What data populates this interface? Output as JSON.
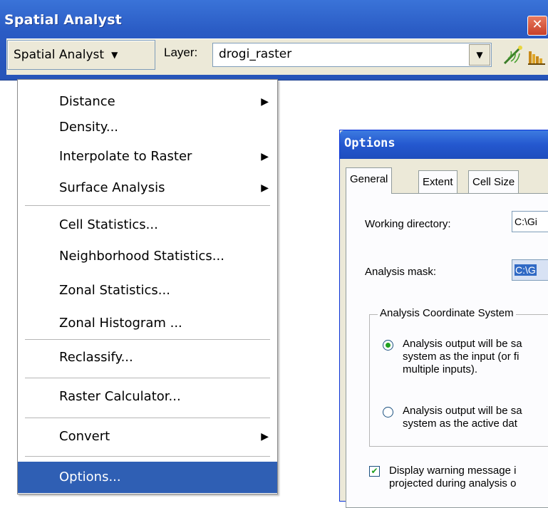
{
  "toolbar": {
    "title": "Spatial Analyst",
    "close_glyph": "✕",
    "menu_button_label": "Spatial Analyst",
    "menu_button_arrow": "▼",
    "layer_label": "Layer:",
    "layer_value": "drogi_raster",
    "layer_drop_arrow": "▼",
    "icons": [
      "contour-wand-icon",
      "histogram-icon"
    ]
  },
  "menu": {
    "items": [
      {
        "label": "Distance",
        "submenu": true
      },
      {
        "label": "Density...",
        "submenu": false
      },
      {
        "label": "Interpolate to Raster",
        "submenu": true
      },
      {
        "label": "Surface Analysis",
        "submenu": true
      },
      {
        "label": "Cell Statistics...",
        "submenu": false
      },
      {
        "label": "Neighborhood Statistics...",
        "submenu": false
      },
      {
        "label": "Zonal Statistics...",
        "submenu": false
      },
      {
        "label": "Zonal Histogram ...",
        "submenu": false
      },
      {
        "label": "Reclassify...",
        "submenu": false
      },
      {
        "label": "Raster Calculator...",
        "submenu": false
      },
      {
        "label": "Convert",
        "submenu": true
      },
      {
        "label": "Options...",
        "submenu": false,
        "selected": true
      }
    ],
    "submenu_arrow": "▶",
    "highlight_color": "#2f5fb4"
  },
  "options_dialog": {
    "title": "Options",
    "tabs": [
      "General",
      "Extent",
      "Cell Size"
    ],
    "active_tab": "General",
    "working_directory_label": "Working directory:",
    "working_directory_value": "C:\\Gi",
    "analysis_mask_label": "Analysis mask:",
    "analysis_mask_value": "C:\\G",
    "coord_group_title": "Analysis Coordinate System",
    "radio_input_text": "Analysis output will be sa\nsystem as the input (or fi\nmultiple inputs).",
    "radio_active_text": "Analysis output will be sa\nsystem as the active dat",
    "radio_input_selected": true,
    "check_warning_text": "Display warning message i\nprojected during analysis o",
    "check_warning_checked": true,
    "check_glyph": "✔"
  }
}
